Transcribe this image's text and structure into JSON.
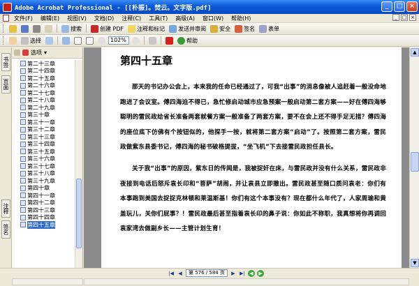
{
  "window": {
    "title": "Adobe Acrobat Professional - [[朴振]。焚云。文字版.pdf]",
    "minimize": "_",
    "maximize": "□",
    "close": "×"
  },
  "menu": {
    "items": [
      "文件(F)",
      "编辑(E)",
      "视图(V)",
      "文档(D)",
      "注释(C)",
      "工具(T)",
      "高级(A)",
      "窗口(W)",
      "帮助(H)"
    ],
    "right": [
      "_",
      "□",
      "×"
    ]
  },
  "toolbar1": {
    "search": "搜索",
    "new_pdf": "创建 PDF",
    "review": "注释和标记",
    "send_review": "发送并审阅",
    "secure": "安全",
    "sign": "签名",
    "forms": "表单"
  },
  "toolbar2": {
    "select": "选择",
    "zoom": "102%",
    "help": "帮助"
  },
  "left_tabs": {
    "tab1": "书签",
    "tab2": "页面",
    "tab3": "注释",
    "tab4": "签名"
  },
  "bookmarks": {
    "options": "选项",
    "items": [
      "第二十三章",
      "第二十四章",
      "第二十五章",
      "第二十六章",
      "第二十七章",
      "第二十八章",
      "第二十九章",
      "第三十章",
      "第三十一章",
      "第三十二章",
      "第三十三章",
      "第三十四章",
      "第三十五章",
      "第三十六章",
      "第三十七章",
      "第三十八章",
      "第三十九章",
      "第四十章",
      "第四十一章",
      "第四十二章",
      "第四十三章",
      "第四十四章",
      "第四十五章"
    ],
    "selected_index": 22
  },
  "document": {
    "chapter_title": "第四十五章",
    "paragraphs": [
      "那天的书记办公会上，本来我的任命已经通过了，可我“出事”的消息像被人追赶着一般没命地跑进了会议室。傅四海迫不得已，急忙修启动城市应急预案一般启动第二套方案——好在傅四海够聪明的雷民政给省长准备两套就餐方案一般准备了两套方案，要不在会上还不得手足无措？傅四海的座位底下仿佛有个按钮似的，他探手一按，就将第二套方案“启动”了。按照第二套方案，雷民政做紫东县委书记，傅四海的秘书破格提拔，“坐飞机”下去接雷民政担任县长。",
      "关于我“出事”的原因，紫东日的传闻是，我被捉奸在床，与雷民政并没有什么关系，雷民政非夜接到电话后怒斥袁长印和“菩萨”胡闹，并让袁县立即撤出。雷民政甚至随口质问袁老：你们有本事跑到美国去捉捉克林顿和莱温斯基！你们有这个本事没有？现在都什么年代了，人家周瑜和黄盖玩儿，关你们屁事？！雷民政最后甚至指着袁长印的鼻子说：你如此不称职，我真想将你再调回袁家湾去做副乡长——主管计划生育！"
    ]
  },
  "statusbar": {
    "page_indicator": "第 576 / 584 页"
  }
}
